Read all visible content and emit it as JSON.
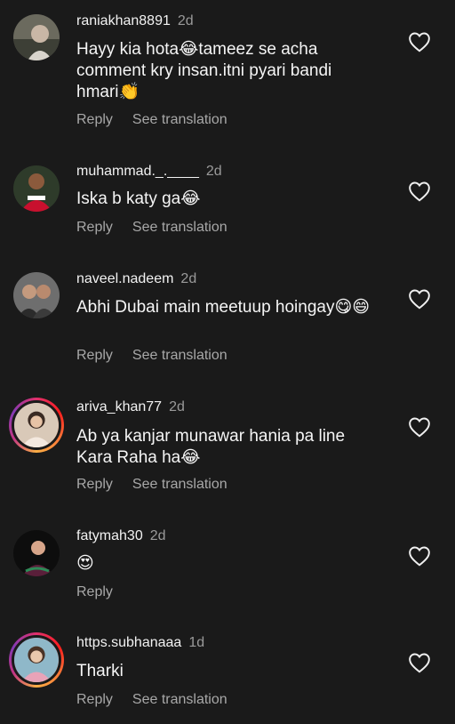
{
  "comments": [
    {
      "username": "raniakhan8891",
      "time": "2d",
      "text": "Hayy kia hota😂tameez se acha comment kry insan.itni pyari bandi hmari👏",
      "reply_label": "Reply",
      "translate_label": "See translation",
      "avatar_icon": "avatar-photo",
      "story_ring": false
    },
    {
      "username": "muhammad._.____",
      "time": "2d",
      "text": "Iska b katy ga😂",
      "reply_label": "Reply",
      "translate_label": "See translation",
      "avatar_icon": "avatar-photo",
      "story_ring": false
    },
    {
      "username": "naveel.nadeem",
      "time": "2d",
      "text": "Abhi Dubai main meetuup hoingay😋😄",
      "reply_label": "Reply",
      "translate_label": "See translation",
      "avatar_icon": "avatar-photo",
      "story_ring": false
    },
    {
      "username": "ariva_khan77",
      "time": "2d",
      "text": "Ab ya kanjar munawar hania pa line Kara Raha ha😂",
      "reply_label": "Reply",
      "translate_label": "See translation",
      "avatar_icon": "avatar-photo",
      "story_ring": true
    },
    {
      "username": "fatymah30",
      "time": "2d",
      "text": "😍",
      "reply_label": "Reply",
      "translate_label": "",
      "avatar_icon": "avatar-photo",
      "story_ring": false
    },
    {
      "username": "https.subhanaaa",
      "time": "1d",
      "text": "Tharki",
      "reply_label": "Reply",
      "translate_label": "See translation",
      "avatar_icon": "avatar-photo",
      "story_ring": true
    }
  ],
  "colors": {
    "background": "#1a1a1a",
    "username": "#f2f2f2",
    "muted": "#a8a8a8",
    "story_ring": "#e1306c"
  },
  "icons": {
    "like": "heart-outline-icon"
  }
}
